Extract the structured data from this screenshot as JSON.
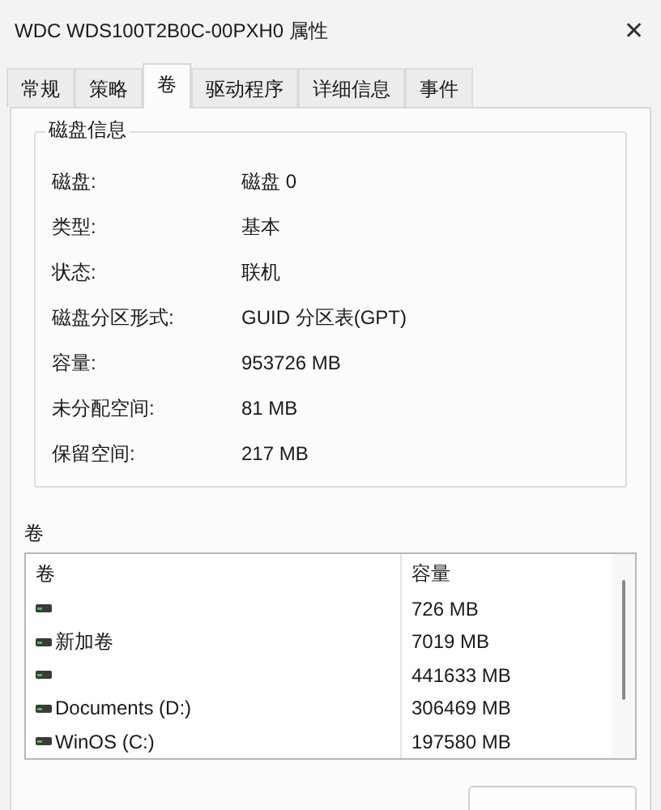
{
  "window": {
    "title": "WDC WDS100T2B0C-00PXH0 属性",
    "close": "✕"
  },
  "tabs": [
    {
      "label": "常规",
      "selected": false
    },
    {
      "label": "策略",
      "selected": false
    },
    {
      "label": "卷",
      "selected": true
    },
    {
      "label": "驱动程序",
      "selected": false
    },
    {
      "label": "详细信息",
      "selected": false
    },
    {
      "label": "事件",
      "selected": false
    }
  ],
  "disk_info": {
    "title": "磁盘信息",
    "rows": [
      {
        "label": "磁盘:",
        "value": "磁盘 0"
      },
      {
        "label": "类型:",
        "value": "基本"
      },
      {
        "label": "状态:",
        "value": "联机"
      },
      {
        "label": "磁盘分区形式:",
        "value": "GUID 分区表(GPT)"
      },
      {
        "label": "容量:",
        "value": "953726 MB"
      },
      {
        "label": "未分配空间:",
        "value": "81 MB"
      },
      {
        "label": "保留空间:",
        "value": "217 MB"
      }
    ]
  },
  "volumes": {
    "title": "卷",
    "columns": [
      "卷",
      "容量"
    ],
    "rows": [
      {
        "name": "",
        "capacity": "726 MB"
      },
      {
        "name": "新加卷",
        "capacity": "7019 MB"
      },
      {
        "name": "",
        "capacity": "441633 MB"
      },
      {
        "name": "Documents (D:)",
        "capacity": "306469 MB"
      },
      {
        "name": "WinOS (C:)",
        "capacity": "197580 MB"
      }
    ]
  }
}
